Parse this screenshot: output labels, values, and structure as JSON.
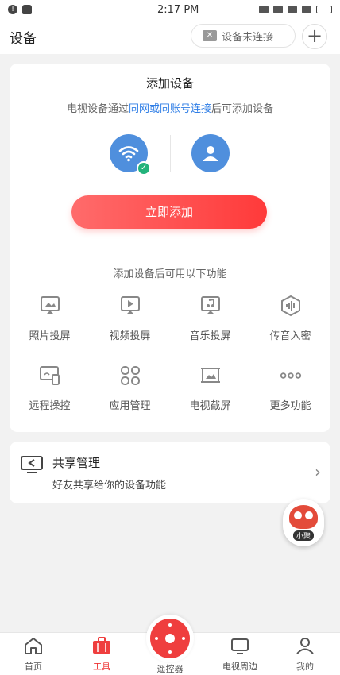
{
  "status_bar": {
    "time": "2:17 PM"
  },
  "header": {
    "title": "设备",
    "connection_status": "设备未连接",
    "add_symbol": "+"
  },
  "add_device": {
    "title": "添加设备",
    "desc_prefix": "电视设备通过",
    "desc_link1": "同网",
    "desc_or": "或",
    "desc_link2": "同账号连接",
    "desc_suffix": "后可添加设备",
    "add_button": "立即添加",
    "features_caption": "添加设备后可用以下功能",
    "features": [
      {
        "label": "照片投屏",
        "icon": "photo-cast-icon"
      },
      {
        "label": "视频投屏",
        "icon": "video-cast-icon"
      },
      {
        "label": "音乐投屏",
        "icon": "music-cast-icon"
      },
      {
        "label": "传音入密",
        "icon": "voice-icon"
      },
      {
        "label": "远程操控",
        "icon": "remote-control-icon"
      },
      {
        "label": "应用管理",
        "icon": "app-manage-icon"
      },
      {
        "label": "电视截屏",
        "icon": "tv-screenshot-icon"
      },
      {
        "label": "更多功能",
        "icon": "more-icon"
      }
    ]
  },
  "share": {
    "title": "共享管理",
    "subtitle": "好友共享给你的设备功能"
  },
  "assistant": {
    "label": "小聚"
  },
  "tabbar": {
    "tabs": [
      {
        "label": "首页",
        "icon": "home-icon"
      },
      {
        "label": "工具",
        "icon": "toolbox-icon",
        "active": true
      },
      {
        "label": "遥控器",
        "icon": "remote-icon"
      },
      {
        "label": "电视周边",
        "icon": "tv-peripheral-icon"
      },
      {
        "label": "我的",
        "icon": "profile-icon"
      }
    ]
  },
  "colors": {
    "accent": "#ef3e3e",
    "link": "#2f7ee6",
    "device_blue": "#4f8fdd",
    "check_green": "#23b37b"
  }
}
